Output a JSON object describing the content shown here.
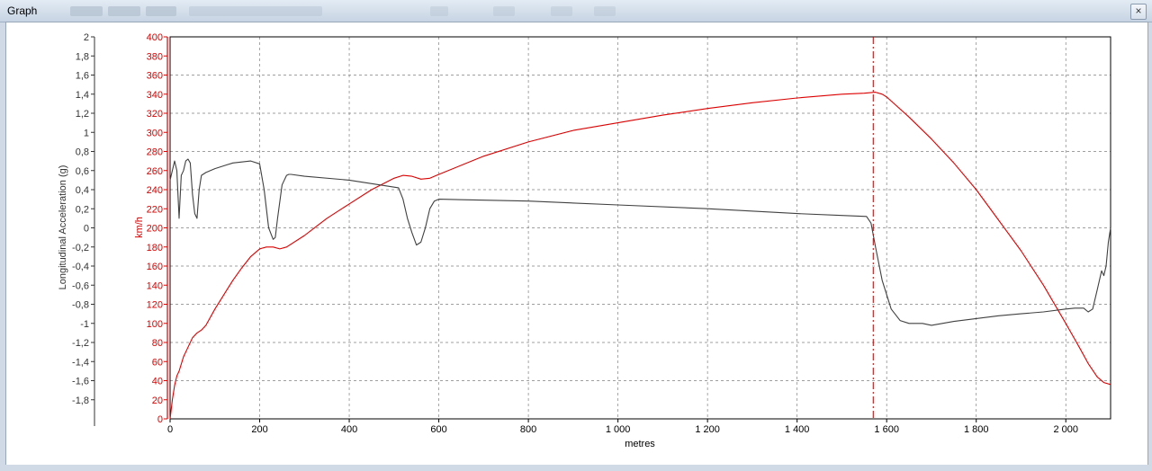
{
  "window": {
    "title": "Graph",
    "close_glyph": "×",
    "blurred_items": [
      "toolbar-field-1",
      "toolbar-field-2",
      "toolbar-field-3",
      "run-time-readout",
      "toolbar-icon-1",
      "toolbar-icon-2",
      "toolbar-icon-3",
      "toolbar-icon-4"
    ]
  },
  "chart_data": {
    "type": "line",
    "xlabel": "metres",
    "xlim": [
      0,
      2100
    ],
    "x_ticks": [
      0,
      200,
      400,
      600,
      800,
      1000,
      1200,
      1400,
      1600,
      1800,
      2000
    ],
    "x_tick_labels": [
      "0",
      "200",
      "400",
      "600",
      "800",
      "1 000",
      "1 200",
      "1 400",
      "1 600",
      "1 800",
      "2 000"
    ],
    "grid": true,
    "cursor_x": 1570,
    "colors": {
      "speed": "#dd0000",
      "accel": "#404040",
      "grid": "#808080",
      "cursor": "#b00000"
    },
    "axes": [
      {
        "id": "accel",
        "label": "Longitudinal Acceleration (g)",
        "range": [
          -2,
          2
        ],
        "ticks": [
          2,
          1.8,
          1.6,
          1.4,
          1.2,
          1,
          0.8,
          0.6,
          0.4,
          0.2,
          0,
          -0.2,
          -0.4,
          -0.6,
          -0.8,
          -1,
          -1.2,
          -1.4,
          -1.6,
          -1.8
        ],
        "tick_labels": [
          "2",
          "1,8",
          "1,6",
          "1,4",
          "1,2",
          "1",
          "0,8",
          "0,6",
          "0,4",
          "0,2",
          "0",
          "-0,2",
          "-0,4",
          "-0,6",
          "-0,8",
          "-1",
          "-1,2",
          "-1,4",
          "-1,6",
          "-1,8"
        ]
      },
      {
        "id": "speed",
        "label": "km/h",
        "range": [
          0,
          400
        ],
        "ticks": [
          400,
          380,
          360,
          340,
          320,
          300,
          280,
          260,
          240,
          220,
          200,
          180,
          160,
          140,
          120,
          100,
          80,
          60,
          40,
          20,
          0
        ],
        "tick_labels": [
          "400",
          "380",
          "360",
          "340",
          "320",
          "300",
          "280",
          "260",
          "240",
          "220",
          "200",
          "180",
          "160",
          "140",
          "120",
          "100",
          "80",
          "60",
          "40",
          "20",
          "0"
        ]
      }
    ],
    "series": [
      {
        "axis": "speed",
        "x": [
          0,
          5,
          10,
          15,
          20,
          30,
          40,
          50,
          60,
          70,
          80,
          100,
          120,
          140,
          160,
          180,
          200,
          215,
          230,
          245,
          260,
          300,
          350,
          400,
          450,
          500,
          520,
          540,
          560,
          580,
          600,
          700,
          800,
          900,
          1000,
          1100,
          1200,
          1300,
          1400,
          1500,
          1550,
          1575,
          1590,
          1600,
          1650,
          1700,
          1750,
          1800,
          1850,
          1900,
          1950,
          2000,
          2030,
          2050,
          2070,
          2085,
          2100
        ],
        "y": [
          0,
          20,
          35,
          45,
          50,
          65,
          75,
          85,
          90,
          93,
          98,
          115,
          130,
          145,
          158,
          170,
          178,
          180,
          180,
          178,
          180,
          192,
          210,
          225,
          240,
          252,
          255,
          254,
          251,
          252,
          256,
          275,
          290,
          302,
          310,
          318,
          325,
          331,
          336,
          340,
          341,
          342,
          340,
          337,
          316,
          293,
          268,
          240,
          208,
          176,
          140,
          100,
          75,
          58,
          44,
          38,
          36
        ]
      },
      {
        "axis": "accel",
        "x": [
          0,
          5,
          10,
          15,
          20,
          25,
          30,
          35,
          40,
          45,
          50,
          55,
          60,
          65,
          70,
          80,
          100,
          140,
          180,
          200,
          210,
          220,
          230,
          235,
          240,
          250,
          260,
          265,
          270,
          300,
          400,
          510,
          520,
          530,
          540,
          550,
          560,
          570,
          580,
          590,
          600,
          800,
          1000,
          1200,
          1400,
          1500,
          1555,
          1565,
          1575,
          1590,
          1610,
          1630,
          1650,
          1680,
          1700,
          1750,
          1800,
          1850,
          1900,
          1950,
          2000,
          2020,
          2040,
          2050,
          2060,
          2070,
          2080,
          2085,
          2090,
          2095,
          2100
        ],
        "y": [
          0.5,
          0.6,
          0.7,
          0.6,
          0.1,
          0.55,
          0.6,
          0.7,
          0.72,
          0.68,
          0.35,
          0.15,
          0.1,
          0.4,
          0.55,
          0.58,
          0.62,
          0.68,
          0.7,
          0.67,
          0.4,
          0.0,
          -0.12,
          -0.1,
          0.1,
          0.45,
          0.55,
          0.56,
          0.56,
          0.54,
          0.5,
          0.42,
          0.3,
          0.1,
          -0.05,
          -0.18,
          -0.15,
          0.0,
          0.2,
          0.28,
          0.3,
          0.28,
          0.24,
          0.2,
          0.15,
          0.13,
          0.12,
          0.05,
          -0.2,
          -0.55,
          -0.85,
          -0.97,
          -1.0,
          -1.0,
          -1.02,
          -0.98,
          -0.95,
          -0.92,
          -0.9,
          -0.88,
          -0.85,
          -0.84,
          -0.84,
          -0.88,
          -0.85,
          -0.65,
          -0.45,
          -0.5,
          -0.4,
          -0.15,
          0.0
        ]
      }
    ]
  }
}
